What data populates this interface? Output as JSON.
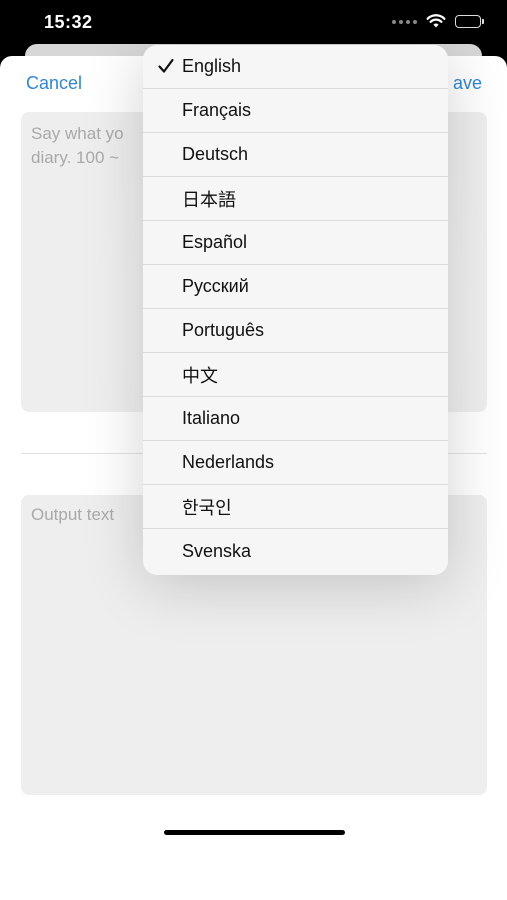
{
  "status_bar": {
    "time": "15:32"
  },
  "nav": {
    "cancel_label": "Cancel",
    "save_label_partial": "ave"
  },
  "input": {
    "placeholder": "Say what yo\ndiary. 100 ~"
  },
  "output": {
    "placeholder": "Output text"
  },
  "language_menu": {
    "selected": "English",
    "items": [
      {
        "label": "English",
        "selected": true
      },
      {
        "label": "Français",
        "selected": false
      },
      {
        "label": "Deutsch",
        "selected": false
      },
      {
        "label": "日本語",
        "selected": false
      },
      {
        "label": "Español",
        "selected": false
      },
      {
        "label": "Русский",
        "selected": false
      },
      {
        "label": "Português",
        "selected": false
      },
      {
        "label": "中文",
        "selected": false
      },
      {
        "label": "Italiano",
        "selected": false
      },
      {
        "label": "Nederlands",
        "selected": false
      },
      {
        "label": "한국인",
        "selected": false
      },
      {
        "label": "Svenska",
        "selected": false
      }
    ]
  },
  "colors": {
    "accent": "#2f86d6",
    "placeholder_text": "#a9a9a9",
    "field_background": "#eeeeee",
    "menu_background": "#f6f6f6"
  },
  "icons": {
    "status": [
      "signal-icon",
      "wifi-icon",
      "battery-icon"
    ],
    "menu": [
      "checkmark-icon"
    ]
  }
}
